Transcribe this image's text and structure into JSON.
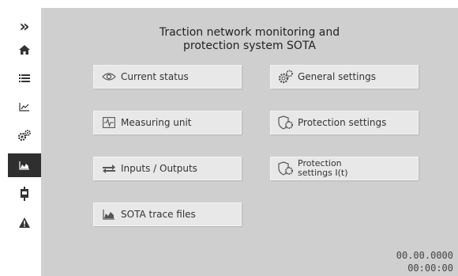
{
  "sidebar": {
    "expand_glyph": "»",
    "items": [
      {
        "icon": "home-icon"
      },
      {
        "icon": "list-icon"
      },
      {
        "icon": "trend-chart-icon"
      },
      {
        "icon": "gears-icon"
      },
      {
        "icon": "area-chart-icon",
        "active": true
      },
      {
        "icon": "device-icon"
      },
      {
        "icon": "warning-icon"
      }
    ]
  },
  "header": {
    "title_line1": "Traction network monitoring and",
    "title_line2": "protection system SOTA"
  },
  "menu": {
    "current_status": "Current status",
    "general_settings": "General settings",
    "measuring_unit": "Measuring unit",
    "protection_settings": "Protection settings",
    "inputs_outputs": "Inputs / Outputs",
    "protection_settings_it_line1": "Protection",
    "protection_settings_it_line2": "settings I(t)",
    "sota_trace_files": "SOTA trace files"
  },
  "status": {
    "date": "00.00.0000",
    "time": "00:00:00"
  },
  "colors": {
    "panel_bg": "#cfcfcf",
    "button_bg": "#e8e8e8",
    "active_sidebar": "#2f2f2f"
  }
}
